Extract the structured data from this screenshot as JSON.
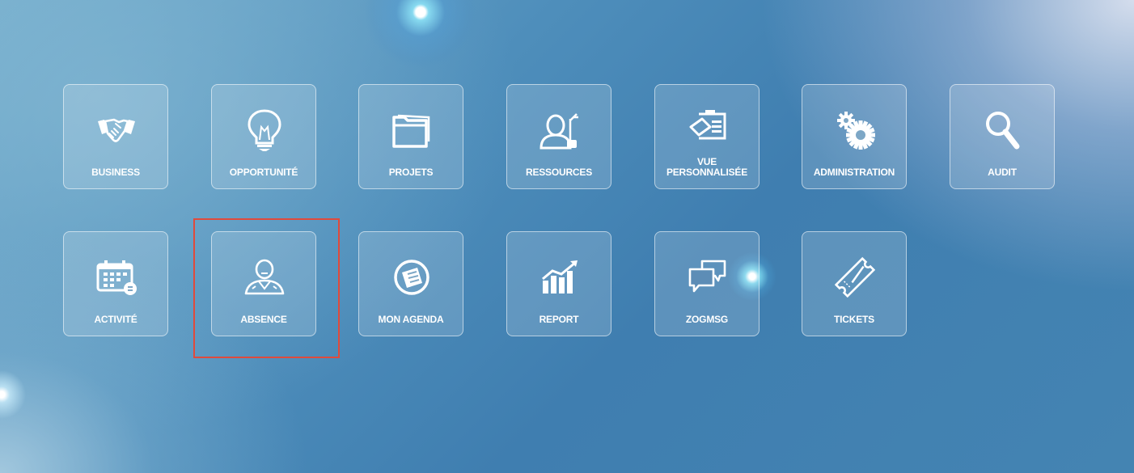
{
  "tiles": [
    {
      "label": "BUSINESS",
      "icon": "handshake-icon"
    },
    {
      "label": "OPPORTUNITÉ",
      "icon": "lightbulb-icon"
    },
    {
      "label": "PROJETS",
      "icon": "folder-icon"
    },
    {
      "label": "RESSOURCES",
      "icon": "resources-person-icon"
    },
    {
      "label": "VUE\nPERSONNALISÉE",
      "icon": "custom-view-icon"
    },
    {
      "label": "ADMINISTRATION",
      "icon": "gears-icon"
    },
    {
      "label": "AUDIT",
      "icon": "magnifier-icon"
    },
    {
      "label": "ACTIVITÉ",
      "icon": "calendar-icon"
    },
    {
      "label": "ABSENCE",
      "icon": "person-away-icon"
    },
    {
      "label": "MON AGENDA",
      "icon": "agenda-icon"
    },
    {
      "label": "REPORT",
      "icon": "bar-chart-icon"
    },
    {
      "label": "ZOGMSG",
      "icon": "chat-bubbles-icon"
    },
    {
      "label": "TICKETS",
      "icon": "ticket-icon"
    }
  ],
  "highlighted_tile": "ABSENCE",
  "colors": {
    "highlight_border": "#e04a3c",
    "tile_border": "rgba(255,255,255,0.55)",
    "text": "#ffffff"
  }
}
